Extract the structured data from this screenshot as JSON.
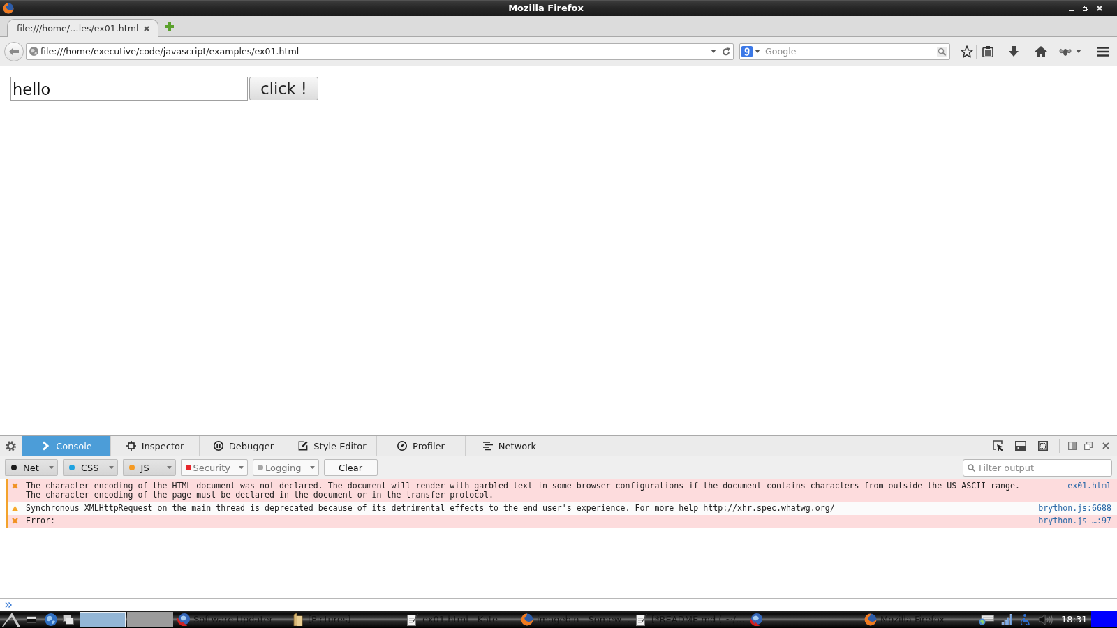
{
  "window": {
    "title": "Mozilla Firefox"
  },
  "tabs": [
    {
      "label": "file:///home/…les/ex01.html",
      "selected": true
    }
  ],
  "navbar": {
    "url": "file:///home/executive/code/javascript/examples/ex01.html",
    "search": {
      "placeholder": "Google"
    }
  },
  "page": {
    "text_input": {
      "value": "hello"
    },
    "button": {
      "label": "click !"
    }
  },
  "devtools": {
    "tabs": [
      {
        "label": "Console",
        "selected": true
      },
      {
        "label": "Inspector",
        "selected": false
      },
      {
        "label": "Debugger",
        "selected": false
      },
      {
        "label": "Style Editor",
        "selected": false
      },
      {
        "label": "Profiler",
        "selected": false
      },
      {
        "label": "Network",
        "selected": false
      }
    ],
    "filters": [
      {
        "label": "Net",
        "checked": true,
        "color": "#1a1a1a"
      },
      {
        "label": "CSS",
        "checked": true,
        "color": "#1fa2e0"
      },
      {
        "label": "JS",
        "checked": true,
        "color": "#f59a23"
      },
      {
        "label": "Security",
        "checked": false,
        "color": "#e6262b"
      },
      {
        "label": "Logging",
        "checked": false,
        "color": "#a6a6a6"
      }
    ],
    "clear_button": {
      "label": "Clear"
    },
    "filter_field": {
      "placeholder": "Filter output"
    },
    "messages": [
      {
        "kind": "error",
        "text": "The character encoding of the HTML document was not declared. The document will render with garbled text in some browser configurations if the document contains characters from outside the US-ASCII range.\nThe character encoding of the page must be declared in the document or in the transfer protocol.",
        "source": "ex01.html"
      },
      {
        "kind": "warning",
        "text": "Synchronous XMLHttpRequest on the main thread is deprecated because of its detrimental effects to the end user's experience. For more help http://xhr.spec.whatwg.org/",
        "source": "brython.js:6688"
      },
      {
        "kind": "error",
        "text": "Error:",
        "source": "brython.js …:97"
      }
    ]
  },
  "taskbar": {
    "desktops": [
      {
        "selected": true
      },
      {
        "selected": false
      }
    ],
    "tasks": [
      {
        "kind": "window",
        "label": "Software Updater"
      },
      {
        "kind": "window",
        "label": "[Pictures]"
      },
      {
        "kind": "window",
        "label": "ex01.html - Kate"
      },
      {
        "kind": "window",
        "label": "imagebin - Somew…"
      },
      {
        "kind": "window",
        "label": "[*README.md ( ~/…"
      },
      {
        "kind": "icon"
      },
      {
        "kind": "window",
        "label": "Mozilla Firefox"
      }
    ],
    "clock": "18:31"
  }
}
